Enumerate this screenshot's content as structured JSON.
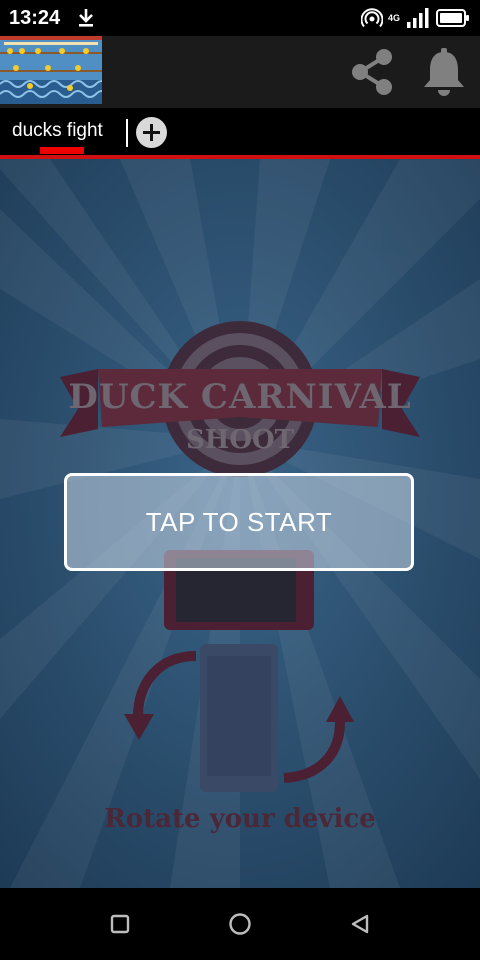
{
  "status_bar": {
    "time": "13:24",
    "signal_label": "4G",
    "icons": [
      "download-icon",
      "hotspot-icon",
      "signal-icon",
      "battery-icon"
    ]
  },
  "app_bar": {
    "icons": [
      "game-thumbnail",
      "share-icon",
      "bell-icon"
    ]
  },
  "tabs": [
    {
      "label": "ducks fight",
      "active": true
    }
  ],
  "add_tab_icon": "plus-icon",
  "game": {
    "logo_line1": "DUCK CARNIVAL",
    "logo_line2": "SHOOT",
    "start_label": "TAP TO START",
    "rotate_text": "Rotate your device"
  },
  "nav_bar": {
    "icons": [
      "recents-square-icon",
      "home-circle-icon",
      "back-triangle-icon"
    ]
  },
  "colors": {
    "accent": "#d01010",
    "game_bg": "#2a4d6b",
    "banner": "#5c2a3a"
  }
}
